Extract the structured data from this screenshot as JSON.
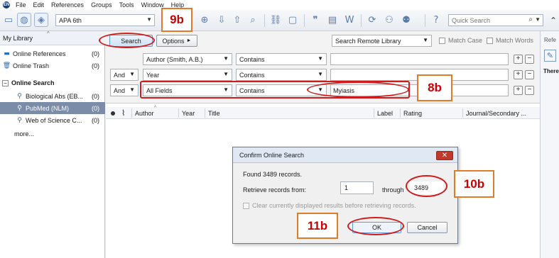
{
  "menubar": {
    "items": [
      "File",
      "Edit",
      "References",
      "Groups",
      "Tools",
      "Window",
      "Help"
    ]
  },
  "toolbar": {
    "style_value": "APA 6th",
    "quick_search_placeholder": "Quick Search"
  },
  "sidebar": {
    "header": "My Library",
    "items": [
      {
        "label": "Online References",
        "count": "(0)",
        "icon": "online-references-icon"
      },
      {
        "label": "Online Trash",
        "count": "(0)",
        "icon": "trash-icon"
      }
    ],
    "group_label": "Online Search",
    "sources": [
      {
        "label": "Biological Abs (EB...",
        "count": "(0)"
      },
      {
        "label": "PubMed (NLM)",
        "count": "(0)",
        "selected": true
      },
      {
        "label": "Web of Science C...",
        "count": "(0)"
      }
    ],
    "more_label": "more..."
  },
  "search": {
    "search_button": "Search",
    "options_button": "Options",
    "remote_mode": "Search Remote Library",
    "match_case": "Match Case",
    "match_words": "Match Words",
    "rows": [
      {
        "bool": "",
        "field": "Author (Smith, A.B.)",
        "operator": "Contains",
        "value": ""
      },
      {
        "bool": "And",
        "field": "Year",
        "operator": "Contains",
        "value": ""
      },
      {
        "bool": "And",
        "field": "All Fields",
        "operator": "Contains",
        "value": "Myiasis"
      }
    ]
  },
  "ref_list": {
    "columns": [
      "Author",
      "Year",
      "Title",
      "Label",
      "Rating",
      "Journal/Secondary ..."
    ]
  },
  "right_pane": {
    "tab": "Refe",
    "text": "There"
  },
  "dialog": {
    "title": "Confirm Online Search",
    "found": "Found 3489 records.",
    "retrieve_label": "Retrieve records from:",
    "from_value": "1",
    "through_label": "through",
    "through_value": "3489",
    "clear_label": "Clear currently displayed results before retrieving records.",
    "ok": "OK",
    "cancel": "Cancel"
  },
  "annotations": {
    "a9b": "9b",
    "a8b": "8b",
    "a10b": "10b",
    "a11b": "11b"
  },
  "colors": {
    "annotation_red": "#d01c1c",
    "annotation_orange": "#e07b2a",
    "selection": "#7b8ca8"
  }
}
